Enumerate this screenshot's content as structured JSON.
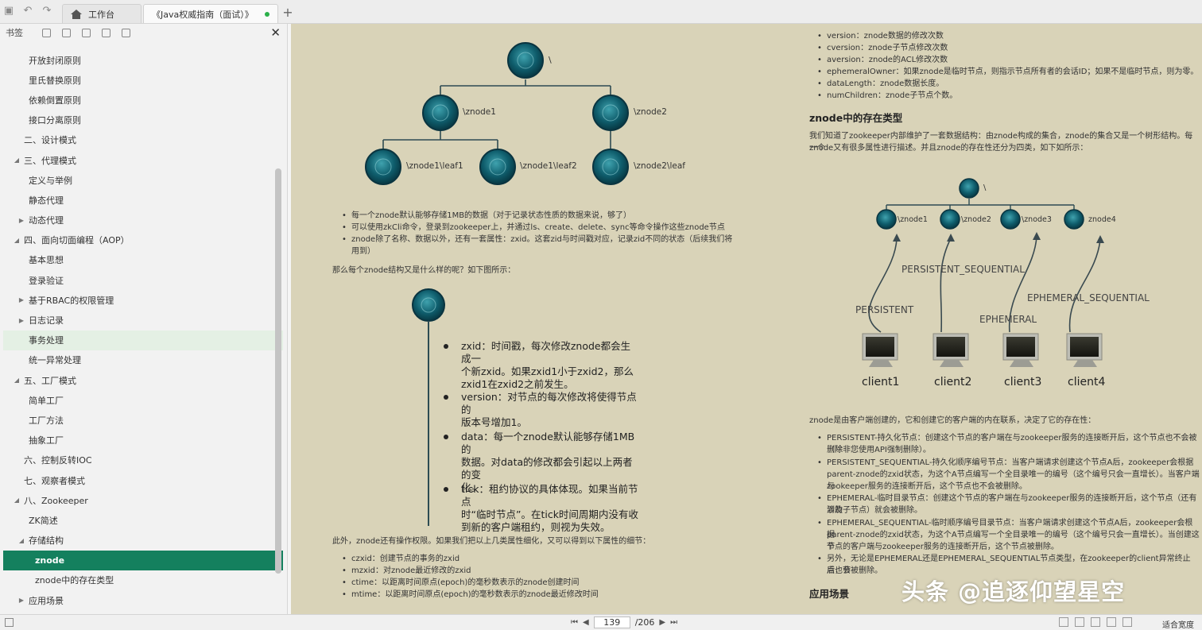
{
  "tabs": {
    "home_label": "工作台",
    "doc_label": "《Java权威指南（面试）》"
  },
  "sidebar": {
    "title": "书签",
    "items": [
      {
        "label": "开放封闭原则",
        "level": 2,
        "arrow": ""
      },
      {
        "label": "里氏替换原则",
        "level": 2,
        "arrow": ""
      },
      {
        "label": "依赖倒置原则",
        "level": 2,
        "arrow": ""
      },
      {
        "label": "接口分离原则",
        "level": 2,
        "arrow": ""
      },
      {
        "label": "二、设计模式",
        "level": 1,
        "arrow": ""
      },
      {
        "label": "三、代理模式",
        "level": 1,
        "arrow": "expanded"
      },
      {
        "label": "定义与举例",
        "level": 2,
        "arrow": ""
      },
      {
        "label": "静态代理",
        "level": 2,
        "arrow": ""
      },
      {
        "label": "动态代理",
        "level": 2,
        "arrow": "collapsed"
      },
      {
        "label": "四、面向切面编程（AOP）",
        "level": 1,
        "arrow": "expanded"
      },
      {
        "label": "基本思想",
        "level": 2,
        "arrow": ""
      },
      {
        "label": "登录验证",
        "level": 2,
        "arrow": ""
      },
      {
        "label": "基于RBAC的权限管理",
        "level": 2,
        "arrow": "collapsed"
      },
      {
        "label": "日志记录",
        "level": 2,
        "arrow": "collapsed"
      },
      {
        "label": "事务处理",
        "level": 2,
        "arrow": "",
        "state": "hl"
      },
      {
        "label": "统一异常处理",
        "level": 2,
        "arrow": ""
      },
      {
        "label": "五、工厂模式",
        "level": 1,
        "arrow": "expanded"
      },
      {
        "label": "简单工厂",
        "level": 2,
        "arrow": ""
      },
      {
        "label": "工厂方法",
        "level": 2,
        "arrow": ""
      },
      {
        "label": "抽象工厂",
        "level": 2,
        "arrow": ""
      },
      {
        "label": "六、控制反转IOC",
        "level": 1,
        "arrow": ""
      },
      {
        "label": "七、观察者模式",
        "level": 1,
        "arrow": ""
      },
      {
        "label": "八、Zookeeper",
        "level": 1,
        "arrow": "expanded"
      },
      {
        "label": "ZK简述",
        "level": 2,
        "arrow": ""
      },
      {
        "label": "存储结构",
        "level": 2,
        "arrow": "expanded"
      },
      {
        "label": "znode",
        "level": 3,
        "arrow": "",
        "state": "sel"
      },
      {
        "label": "znode中的存在类型",
        "level": 3,
        "arrow": ""
      },
      {
        "label": "应用场景",
        "level": 2,
        "arrow": "collapsed"
      }
    ]
  },
  "left_page": {
    "tree1": {
      "root": "\\",
      "n1": "\\znode1",
      "n2": "\\znode2",
      "leaf1": "\\znode1\\leaf1",
      "leaf2": "\\znode1\\leaf2",
      "leaf3": "\\znode2\\leaf"
    },
    "bullets1": [
      "每一个znode默认能够存储1MB的数据（对于记录状态性质的数据来说，够了）",
      "可以使用zkCli命令，登录到zookeeper上，并通过ls、create、delete、sync等命令操作这些znode节点",
      "znode除了名称、数据以外，还有一套属性：zxid。这套zid与时间戳对应，记录zid不同的状态（后续我们将",
      "用到）"
    ],
    "question": "那么每个znode结构又是什么样的呢？如下图所示：",
    "diagram2": [
      {
        "l1": "zxid：时间戳，每次修改znode都会生成一",
        "l2": "个新zxid。如果zxid1小于zxid2，那么",
        "l3": "zxid1在zxid2之前发生。"
      },
      {
        "l1": "version：对节点的每次修改将使得节点的",
        "l2": "版本号增加1。",
        "l3": ""
      },
      {
        "l1": "data：每一个znode默认能够存储1MB的",
        "l2": "数据。对data的修改都会引起以上两者的变",
        "l3": "化。"
      },
      {
        "l1": "tick：租约协议的具体体现。如果当前节点",
        "l2": "时“临时节点”。在tick时间周期内没有收",
        "l3": "到新的客户端租约，则视为失效。"
      }
    ],
    "extra": "此外，znode还有操作权限。如果我们把以上几类属性细化，又可以得到以下属性的细节：",
    "bullets2": [
      "czxid：创建节点的事务的zxid",
      "mzxid：对znode最近修改的zxid",
      "ctime：以距离时间原点(epoch)的毫秒数表示的znode创建时间",
      "mtime：以距离时间原点(epoch)的毫秒数表示的znode最近修改时间"
    ]
  },
  "right_page": {
    "bullets_top": [
      "version：znode数据的修改次数",
      "cversion：znode子节点修改次数",
      "aversion：znode的ACL修改次数",
      "ephemeralOwner：如果znode是临时节点，则指示节点所有者的会话ID；如果不是临时节点，则为零。",
      "dataLength：znode数据长度。",
      "numChildren：znode子节点个数。"
    ],
    "heading1": "znode中的存在类型",
    "para1a": "我们知道了zookeeper内部维护了一套数据结构：由znode构成的集合，znode的集合又是一个树形结构。每一个",
    "para1b": "znode又有很多属性进行描述。并且znode的存在性还分为四类，如下如所示：",
    "diagram": {
      "root": "\\",
      "nodes": [
        "\\znode1",
        "\\znode2",
        "\\znode3",
        "znode4"
      ],
      "labels": [
        "PERSISTENT_SEQUENTIAL",
        "PERSISTENT",
        "EPHEMERAL",
        "EPHEMERAL_SEQUENTIAL"
      ],
      "clients": [
        "client1",
        "client2",
        "client3",
        "client4"
      ]
    },
    "para2": "znode是由客户端创建的，它和创建它的客户端的内在联系，决定了它的存在性：",
    "bullets_bottom": [
      "PERSISTENT-持久化节点：创建这个节点的客户端在与zookeeper服务的连接断开后，这个节点也不会被删除",
      "（除非您使用API强制删除）。",
      "PERSISTENT_SEQUENTIAL-持久化顺序编号节点：当客户端请求创建这个节点A后，zookeeper会根据",
      "parent-znode的zxid状态，为这个A节点编写一个全目录唯一的编号（这个编号只会一直增长）。当客户端与",
      "zookeeper服务的连接断开后，这个节点也不会被删除。",
      "EPHEMERAL-临时目录节点：创建这个节点的客户端在与zookeeper服务的连接断开后，这个节点（还有涉及",
      "到的子节点）就会被删除。",
      "EPHEMERAL_SEQUENTIAL-临时顺序编号目录节点：当客户端请求创建这个节点A后，zookeeper会根据",
      "parent-znode的zxid状态，为这个A节点编写一个全目录唯一的编号（这个编号只会一直增长）。当创建这个",
      "节点的客户端与zookeeper服务的连接断开后，这个节点被删除。",
      "另外，无论是EPHEMERAL还是EPHEMERAL_SEQUENTIAL节点类型，在zookeeper的client异常终止后，节",
      "点也会被删除。"
    ],
    "heading2": "应用场景"
  },
  "watermark": "头条 @追逐仰望星空",
  "statusbar": {
    "page_value": "139",
    "page_total": "/206",
    "zoom_label": "适合宽度"
  }
}
